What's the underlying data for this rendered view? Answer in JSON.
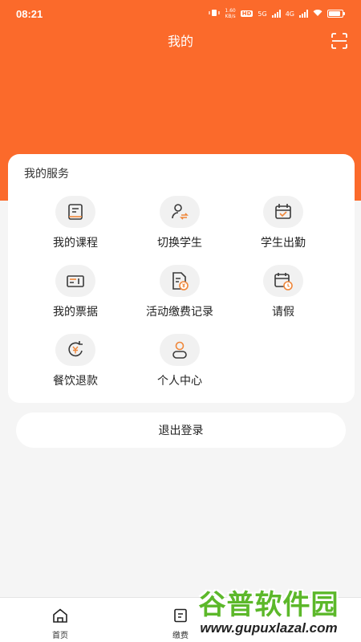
{
  "status_bar": {
    "time": "08:21",
    "net_speed_top": "1.60",
    "net_speed_bottom": "KB/s",
    "hd_label": "HD",
    "sim1_label": "5G",
    "sim2_label": "4G"
  },
  "header": {
    "title": "我的",
    "scan_icon": "scan-icon"
  },
  "services": {
    "title": "我的服务",
    "items": [
      {
        "label": "我的课程",
        "icon": "book-icon"
      },
      {
        "label": "切换学生",
        "icon": "switch-user-icon"
      },
      {
        "label": "学生出勤",
        "icon": "calendar-check-icon"
      },
      {
        "label": "我的票据",
        "icon": "ticket-icon"
      },
      {
        "label": "活动缴费记录",
        "icon": "payment-record-icon"
      },
      {
        "label": "请假",
        "icon": "leave-calendar-icon"
      },
      {
        "label": "餐饮退款",
        "icon": "refund-icon"
      },
      {
        "label": "个人中心",
        "icon": "person-icon"
      }
    ]
  },
  "logout": {
    "label": "退出登录"
  },
  "tab_bar": {
    "tabs": [
      {
        "label": "首页",
        "icon": "home-icon"
      },
      {
        "label": "缴费",
        "icon": "payment-icon"
      },
      {
        "label": "",
        "icon": ""
      }
    ]
  },
  "watermark": {
    "main": "谷普软件园",
    "url": "www.gupuxlazal.com"
  },
  "colors": {
    "brand_orange": "#fb6a2b",
    "icon_stroke": "#3a3a3a",
    "icon_accent": "#f0873a",
    "page_bg": "#f5f5f5"
  }
}
